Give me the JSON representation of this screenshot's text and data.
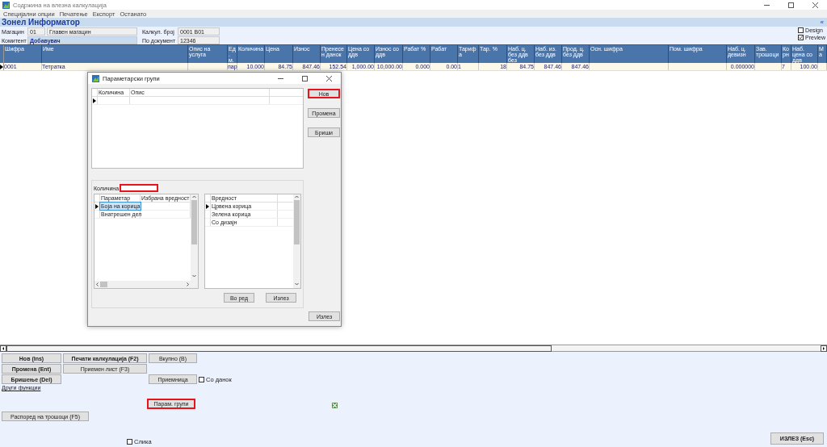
{
  "window": {
    "title": "Содржина на влезна калкулација"
  },
  "menu": [
    "Специјални опции",
    "Печатење",
    "Експорт",
    "Останато"
  ],
  "header": {
    "title": "Зонел Информатор",
    "collapse": "«"
  },
  "form": {
    "warehouse_label": "Магацин",
    "warehouse_code": "01",
    "warehouse_name": "Главен магацин",
    "calc_label": "Калкул. број",
    "calc_value": "0001   B01",
    "partner_label": "Комитент",
    "partner_value": "Добавувач",
    "doc_label": "По документ",
    "doc_value": "12346",
    "options": [
      {
        "label": "Design",
        "checked": false
      },
      {
        "label": "Preview",
        "checked": true
      }
    ]
  },
  "table": {
    "columns": [
      "Шифра",
      "Име",
      "Опис на услуга",
      "Ед. м.",
      "Количина",
      "Цена",
      "Износ",
      "Пренесен данок",
      "Цена со ддв",
      "Износ со ддв",
      "Рабат %",
      "Рабат",
      "Тарифа",
      "Тар. %",
      "Наб. ц. без ддв без",
      "Наб. из. без ддв",
      "Прод. ц. без ддв",
      "Осн. шифра",
      "Пом. шифра",
      "Наб. ц. девизн",
      "Зав. трошоци",
      "Ко рн",
      "Наб. цена со ддв",
      "Ма"
    ],
    "rows": [
      {
        "current": true,
        "cells": [
          "0001",
          "Тетратка",
          null,
          "пар",
          "10.000",
          "84.75",
          "847.46",
          "152.54",
          "1,000.00",
          "10,000.00",
          "0.000",
          "0.00",
          "1",
          "18",
          "84.75",
          "847.46",
          "847.46",
          null,
          null,
          "0.000000",
          null,
          "7",
          "100.00",
          null
        ]
      }
    ]
  },
  "dialog": {
    "title": "Параметарски групи",
    "top_grid": {
      "columns": [
        "Количина",
        "Опис"
      ]
    },
    "side_buttons": [
      {
        "label": "Нов",
        "highlighted": true
      },
      {
        "label": "Промена",
        "highlighted": false
      },
      {
        "label": "Бриши",
        "highlighted": false
      }
    ],
    "quantity": {
      "label": "Количина",
      "highlighted": true
    },
    "parameters": {
      "columns": [
        "Параметар",
        "Избрана вредност"
      ],
      "rows": [
        {
          "name": "Боја на корица",
          "current": true,
          "selected": true
        },
        {
          "name": "Внатрешен дел",
          "current": false,
          "selected": false
        }
      ]
    },
    "values": {
      "columns": [
        "Вредност"
      ],
      "rows": [
        {
          "name": "Црвена корица",
          "current": true
        },
        {
          "name": "Зелена корица",
          "current": false
        },
        {
          "name": "Со дизајн",
          "current": false
        }
      ]
    },
    "group_buttons": [
      "Во ред",
      "Излез"
    ],
    "exit_button": "Излез"
  },
  "bottom_panel": {
    "buttons_left": [
      {
        "label": "Нов (Ins)",
        "bold": true
      },
      {
        "label": "Промена (Ent)",
        "bold": true
      },
      {
        "label": "Бришење (Del)",
        "bold": true
      }
    ],
    "buttons_print": [
      {
        "label": "Печати калкулација (F2)",
        "bold": true
      },
      {
        "label": "Приемен лист (F3)",
        "bold": false
      }
    ],
    "total_button": "Вкупно (В)",
    "receipt_button": "Приемница",
    "tax_checkbox": {
      "label": "Со данок",
      "checked": false
    },
    "link": "Други функции",
    "param_groups_button": {
      "label": "Парам. групи",
      "highlighted": true
    },
    "cost_button": "Распоред на трошоци (F5)",
    "image_checkbox": {
      "label": "Слика",
      "checked": false
    },
    "exit_button": "ИЗЛЕЗ (Esc)"
  }
}
